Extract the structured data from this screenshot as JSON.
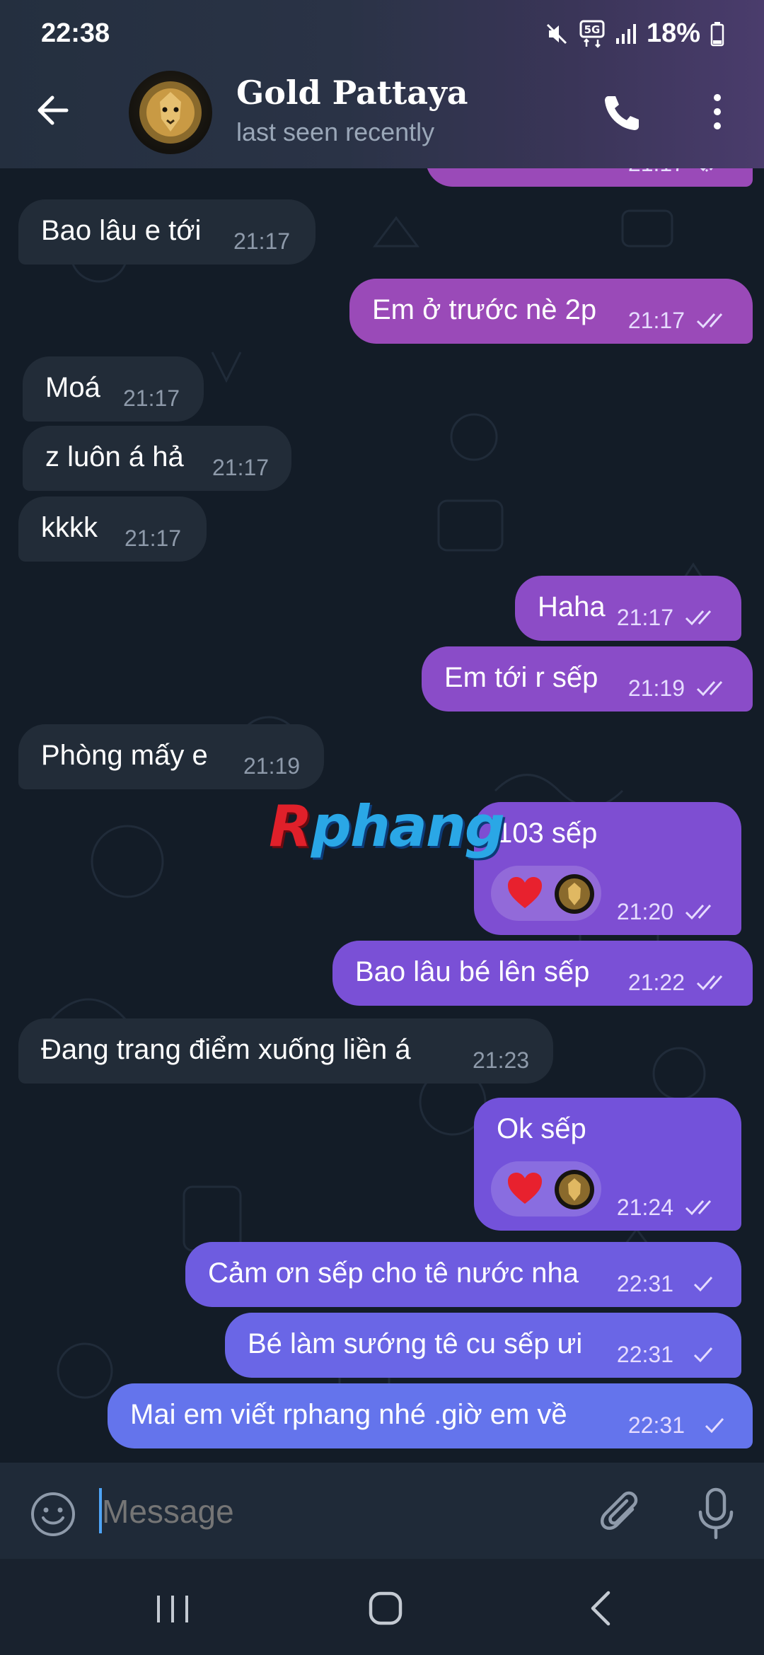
{
  "status": {
    "time": "22:38",
    "battery": "18%",
    "network": "5G",
    "icons": [
      "mute-icon",
      "5g-icon",
      "signal-icon",
      "battery-icon"
    ]
  },
  "header": {
    "title": "Gold Pattaya",
    "subtitle": "last seen recently",
    "icons": [
      "back-arrow-icon",
      "lion-avatar",
      "phone-icon",
      "more-vertical-icon"
    ]
  },
  "watermark": {
    "first": "R",
    "rest": "phang"
  },
  "messages": [
    {
      "dir": "out",
      "text": "",
      "time": "21:17",
      "status": "read"
    },
    {
      "dir": "in",
      "text": "Bao lâu e tới",
      "time": "21:17"
    },
    {
      "dir": "out",
      "text": "Em ở trước nè 2p",
      "time": "21:17",
      "status": "read"
    },
    {
      "dir": "in",
      "text": "Moá",
      "time": "21:17"
    },
    {
      "dir": "in",
      "text": "z luôn á hả",
      "time": "21:17"
    },
    {
      "dir": "in",
      "text": "kkkk",
      "time": "21:17"
    },
    {
      "dir": "out",
      "text": "Haha",
      "time": "21:17",
      "status": "read"
    },
    {
      "dir": "out",
      "text": "Em tới r sếp",
      "time": "21:19",
      "status": "read"
    },
    {
      "dir": "in",
      "text": "Phòng mấy e",
      "time": "21:19"
    },
    {
      "dir": "out",
      "text": "103 sếp",
      "time": "21:20",
      "status": "read",
      "reactions": [
        "heart-icon",
        "lion-avatar"
      ]
    },
    {
      "dir": "out",
      "text": "Bao lâu bé lên sếp",
      "time": "21:22",
      "status": "read"
    },
    {
      "dir": "in",
      "text": "Đang trang điểm xuống liền á",
      "time": "21:23"
    },
    {
      "dir": "out",
      "text": "Ok sếp",
      "time": "21:24",
      "status": "read",
      "reactions": [
        "heart-icon",
        "lion-avatar"
      ]
    },
    {
      "dir": "out",
      "text": "Cảm ơn sếp cho tê nước nha",
      "time": "22:31",
      "status": "sent"
    },
    {
      "dir": "out",
      "text": "Bé làm sướng tê cu sếp ưi",
      "time": "22:31",
      "status": "sent"
    },
    {
      "dir": "out",
      "text": "Mai em viết rphang nhé .giờ em về",
      "time": "22:31",
      "status": "sent"
    }
  ],
  "composer": {
    "placeholder": "Message",
    "icons": [
      "emoji-icon",
      "attach-icon",
      "microphone-icon"
    ]
  },
  "navigation": {
    "icons": [
      "recent-apps-icon",
      "home-icon",
      "back-icon"
    ]
  },
  "colors": {
    "incoming_bubble": "#222c38",
    "outgoing_top": "#9a4ab8",
    "outgoing_mid": "#7a50d6",
    "outgoing_bottom": "#6474ec",
    "accent": "#4ea4f6"
  }
}
